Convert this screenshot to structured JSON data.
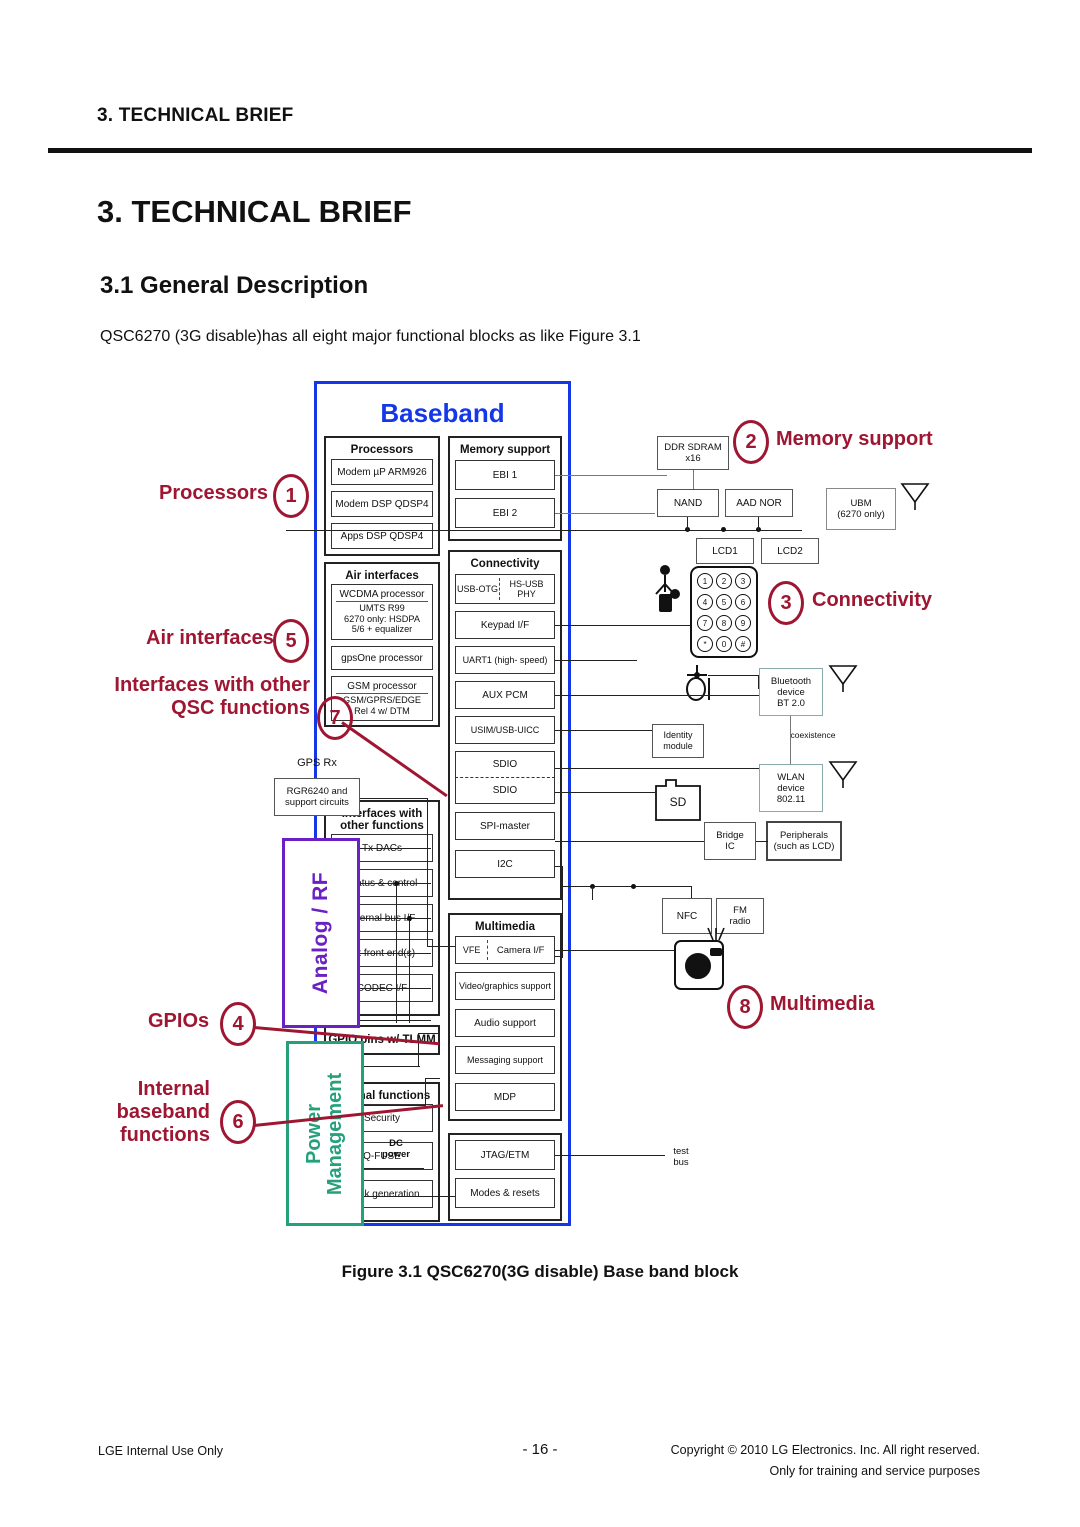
{
  "running_head": "3. TECHNICAL BRIEF",
  "heading": "3. TECHNICAL BRIEF",
  "subheading": "3.1 General Description",
  "intro": "QSC6270 (3G disable)has all eight major functional blocks as like Figure 3.1",
  "figure_caption": "Figure 3.1 QSC6270(3G disable) Base band block",
  "footer": {
    "left": "LGE Internal Use Only",
    "page": "- 16 -",
    "copyright_line1": "Copyright © 2010 LG Electronics. Inc. All right reserved.",
    "copyright_line2": "Only for training and service purposes"
  },
  "colors": {
    "baseband_blue": "#1437e8",
    "callout_red": "#9e1631",
    "analog_purple": "#6a21c4",
    "power_green": "#24a17b"
  },
  "diagram": {
    "baseband_title": "Baseband",
    "groups": {
      "processors": {
        "title": "Processors",
        "items": [
          "Modem µP ARM926",
          "Modem DSP QDSP4",
          "Apps DSP QDSP4"
        ]
      },
      "air_interfaces": {
        "title": "Air interfaces",
        "items": [
          {
            "head": "WCDMA processor",
            "body": "UMTS R99\n6270 only: HSDPA\n5/6 + equalizer"
          },
          {
            "head": "gpsOne processor",
            "body": ""
          },
          {
            "head": "GSM processor",
            "body": "GSM/GPRS/EDGE\nRel 4 w/ DTM"
          }
        ]
      },
      "interfaces_other": {
        "title": "Interfaces with\nother functions",
        "items": [
          "Tx DACs",
          "Status & control",
          "Internal bus I/F",
          "Rx front end(s)",
          "CODEC I/F"
        ]
      },
      "gpio_pins": {
        "label": "GPIO pins w/ TLMM"
      },
      "internal_functions": {
        "title": "Internal functions",
        "items": [
          "Security",
          "Q-FUSE",
          "Clock generation"
        ]
      },
      "memory_support": {
        "title": "Memory support",
        "items": [
          "EBI 1",
          "EBI 2"
        ]
      },
      "connectivity": {
        "title": "Connectivity",
        "items": [
          {
            "left": "USB-OTG",
            "right": "HS-USB\nPHY"
          },
          {
            "label": "Keypad I/F"
          },
          {
            "label": "UART1 (high- speed)"
          },
          {
            "label": "AUX PCM"
          },
          {
            "label": "USIM/USB-UICC"
          },
          {
            "label": "SDIO"
          },
          {
            "label": "SDIO"
          },
          {
            "label": "SPI-master"
          },
          {
            "label": "I2C"
          }
        ]
      },
      "multimedia": {
        "title": "Multimedia",
        "items": [
          {
            "left": "VFE",
            "right": "Camera I/F"
          },
          {
            "label": "Video/graphics support"
          },
          {
            "label": "Audio support"
          },
          {
            "label": "Messaging support"
          },
          {
            "label": "MDP"
          }
        ]
      },
      "test": {
        "items": [
          "JTAG/ETM",
          "Modes & resets"
        ],
        "bus_label": "test\nbus"
      }
    },
    "external": {
      "ddr_sdram": "DDR SDRAM\nx16",
      "nand": "NAND",
      "aad_nor": "AAD NOR",
      "lcd1": "LCD1",
      "lcd2": "LCD2",
      "ubm": "UBM\n(6270 only)",
      "identity_module": "Identity\nmodule",
      "bluetooth": "Bluetooth\ndevice\nBT 2.0",
      "coexistence": "coexistence",
      "wlan": "WLAN\ndevice\n802.11",
      "sd": "SD",
      "bridge_ic": "Bridge\nIC",
      "peripherals": "Peripherals\n(such as LCD)",
      "nfc": "NFC",
      "fm_radio": "FM\nradio",
      "gps_rx": "GPS Rx",
      "rgr6240": "RGR6240 and\nsupport circuits",
      "dc_power": "DC\npower"
    },
    "side_blocks": {
      "analog_rf": "Analog / RF",
      "power_management": "Power\nManagement"
    },
    "callouts": [
      {
        "number": "1",
        "label": "Processors"
      },
      {
        "number": "2",
        "label": "Memory support"
      },
      {
        "number": "3",
        "label": "Connectivity"
      },
      {
        "number": "4",
        "label": "GPIOs"
      },
      {
        "number": "5",
        "label": "Air interfaces"
      },
      {
        "number": "6",
        "label": "Internal\nbaseband\nfunctions"
      },
      {
        "number": "7",
        "label": "Interfaces with other\nQSC functions"
      },
      {
        "number": "8",
        "label": "Multimedia"
      }
    ],
    "keypad_keys": [
      "1",
      "2",
      "3",
      "4",
      "5",
      "6",
      "7",
      "8",
      "9",
      "*",
      "0",
      "#"
    ]
  }
}
